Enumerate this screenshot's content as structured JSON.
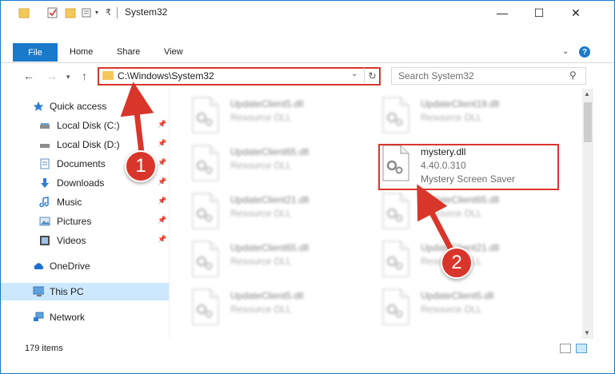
{
  "window": {
    "title": "System32",
    "controls": {
      "minimize": "—",
      "maximize": "☐",
      "close": "✕"
    }
  },
  "ribbon": {
    "tabs": [
      "File",
      "Home",
      "Share",
      "View"
    ],
    "help": "?"
  },
  "nav": {
    "address": "C:\\Windows\\System32",
    "search_placeholder": "Search System32"
  },
  "sidebar": {
    "items": [
      {
        "label": "Quick access",
        "icon": "star-icon"
      },
      {
        "label": "Local Disk (C:)",
        "icon": "drive-icon",
        "pinned": true
      },
      {
        "label": "Local Disk (D:)",
        "icon": "drive-icon",
        "pinned": true
      },
      {
        "label": "Documents",
        "icon": "documents-icon",
        "pinned": true
      },
      {
        "label": "Downloads",
        "icon": "download-icon",
        "pinned": true
      },
      {
        "label": "Music",
        "icon": "music-icon",
        "pinned": true
      },
      {
        "label": "Pictures",
        "icon": "pictures-icon",
        "pinned": true
      },
      {
        "label": "Videos",
        "icon": "videos-icon",
        "pinned": true
      },
      {
        "label": "OneDrive",
        "icon": "cloud-icon"
      },
      {
        "label": "This PC",
        "icon": "computer-icon",
        "selected": true
      },
      {
        "label": "Network",
        "icon": "network-icon"
      }
    ]
  },
  "files": [
    {
      "name": "UpdateClient5.dll",
      "sub": "Resource DLL",
      "blurred": true
    },
    {
      "name": "UpdateClient19.dll",
      "sub": "Resource DLL",
      "blurred": true
    },
    {
      "name": "UpdateClient65.dll",
      "sub": "Resource DLL",
      "blurred": true
    },
    {
      "name": "mystery.dll",
      "sub": "4.40.0.310",
      "sub2": "Mystery Screen Saver",
      "blurred": false,
      "highlighted": true
    },
    {
      "name": "UpdateClient21.dll",
      "sub": "Resource DLL",
      "blurred": true
    },
    {
      "name": "UpdateClient65.dll",
      "sub": "Resource DLL",
      "blurred": true
    },
    {
      "name": "UpdateClient65.dll",
      "sub": "Resource DLL",
      "blurred": true
    },
    {
      "name": "UpdateClient21.dll",
      "sub": "Resource DLL",
      "blurred": true
    },
    {
      "name": "UpdateClient5.dll",
      "sub": "Resource DLL",
      "blurred": true
    },
    {
      "name": "UpdateClient5.dll",
      "sub": "Resource DLL",
      "blurred": true
    }
  ],
  "status": {
    "item_count": "179 items"
  },
  "annotations": {
    "step1": "1",
    "step2": "2",
    "color": "#d9362b"
  }
}
